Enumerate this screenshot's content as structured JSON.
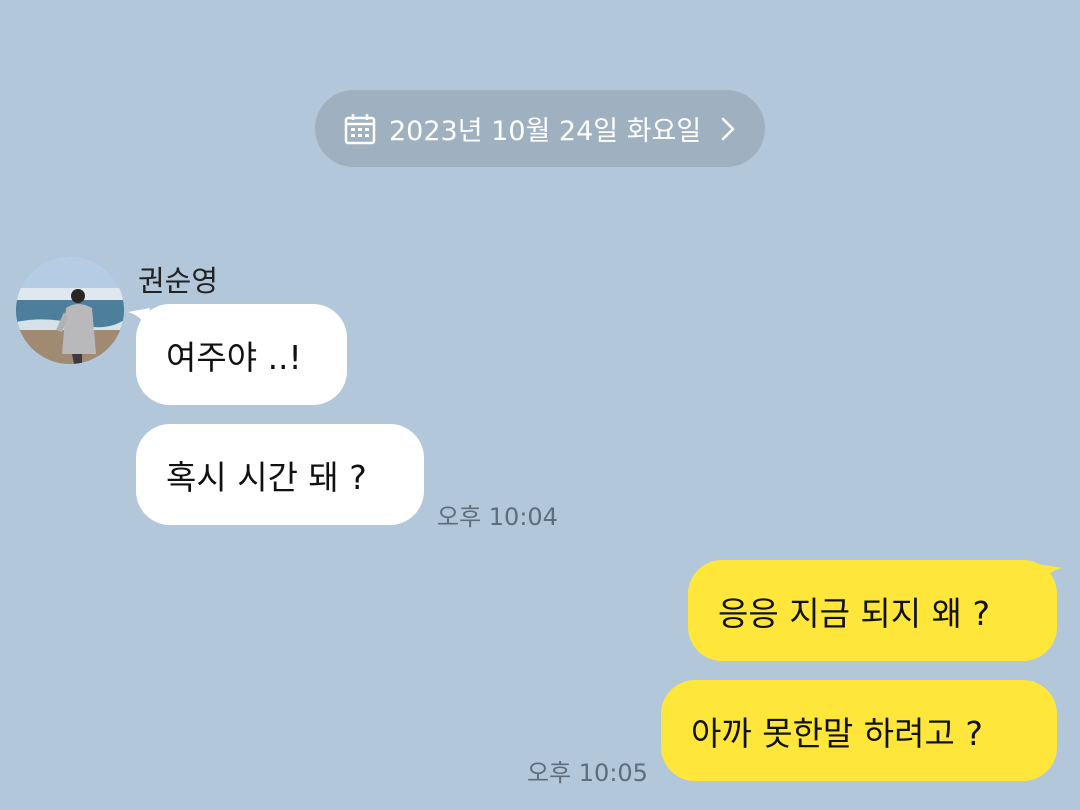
{
  "date_divider": {
    "text": "2023년 10월 24일 화요일",
    "icon_left": "calendar-icon",
    "icon_right": "chevron-right-icon"
  },
  "sender": {
    "name": "권순영",
    "avatar_icon": "profile-photo"
  },
  "messages": [
    {
      "direction": "incoming",
      "text": "여주야 ..!"
    },
    {
      "direction": "incoming",
      "text": "혹시 시간 돼 ?",
      "time": "오후 10:04"
    },
    {
      "direction": "outgoing",
      "text": "응응 지금 되지 왜 ?"
    },
    {
      "direction": "outgoing",
      "text": "아까 못한말 하려고 ?",
      "time": "오후 10:05"
    }
  ],
  "colors": {
    "background": "#b2c7da",
    "date_pill": "#9fb1c1",
    "incoming_bubble": "#ffffff",
    "outgoing_bubble": "#fee73a",
    "time_text": "#5d6d7c"
  }
}
